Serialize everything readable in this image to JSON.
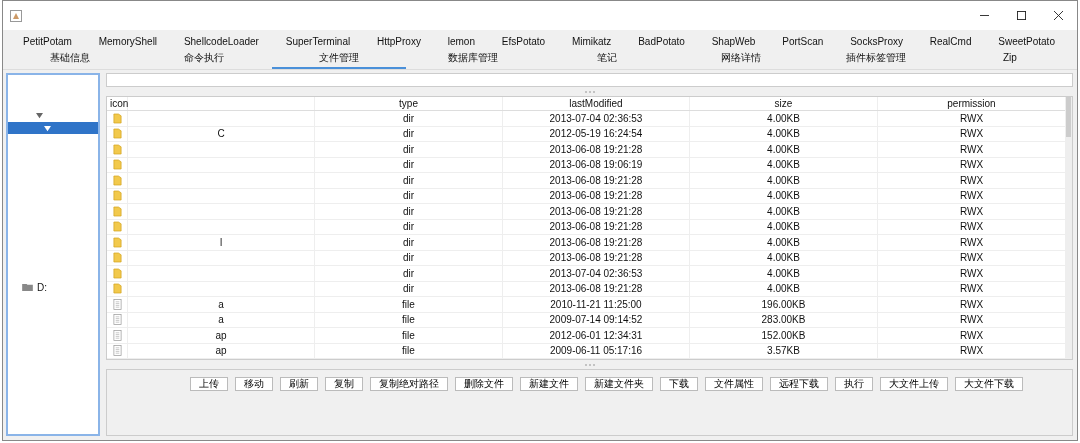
{
  "plugin_tabs": [
    "PetitPotam",
    "MemoryShell",
    "ShellcodeLoader",
    "SuperTerminal",
    "HttpProxy",
    "lemon",
    "EfsPotato",
    "Mimikatz",
    "BadPotato",
    "ShapWeb",
    "PortScan",
    "SocksProxy",
    "RealCmd",
    "SweetPotato"
  ],
  "tabs": [
    {
      "label": "基础信息",
      "selected": false
    },
    {
      "label": "命令执行",
      "selected": false
    },
    {
      "label": "文件管理",
      "selected": true
    },
    {
      "label": "数据库管理",
      "selected": false
    },
    {
      "label": "笔记",
      "selected": false
    },
    {
      "label": "网络详情",
      "selected": false
    },
    {
      "label": "插件标签管理",
      "selected": false
    },
    {
      "label": "Zip",
      "selected": false
    }
  ],
  "tree": [
    {
      "expanded": true,
      "selected": false,
      "children": [
        {
          "expanded": true,
          "selected": true
        }
      ]
    },
    {
      "label": "D:",
      "selected": false
    }
  ],
  "table": {
    "columns": [
      "icon",
      "",
      "type",
      "lastModified",
      "size",
      "permission"
    ],
    "rows": [
      {
        "kind": "dir",
        "name": "",
        "type": "dir",
        "modified": "2013-07-04 02:36:53",
        "size": "4.00KB",
        "permission": "RWX"
      },
      {
        "kind": "dir",
        "name": "C",
        "type": "dir",
        "modified": "2012-05-19 16:24:54",
        "size": "4.00KB",
        "permission": "RWX"
      },
      {
        "kind": "dir",
        "name": "",
        "type": "dir",
        "modified": "2013-06-08 19:21:28",
        "size": "4.00KB",
        "permission": "RWX"
      },
      {
        "kind": "dir",
        "name": "",
        "type": "dir",
        "modified": "2013-06-08 19:06:19",
        "size": "4.00KB",
        "permission": "RWX"
      },
      {
        "kind": "dir",
        "name": "",
        "type": "dir",
        "modified": "2013-06-08 19:21:28",
        "size": "4.00KB",
        "permission": "RWX"
      },
      {
        "kind": "dir",
        "name": "",
        "type": "dir",
        "modified": "2013-06-08 19:21:28",
        "size": "4.00KB",
        "permission": "RWX"
      },
      {
        "kind": "dir",
        "name": "",
        "type": "dir",
        "modified": "2013-06-08 19:21:28",
        "size": "4.00KB",
        "permission": "RWX"
      },
      {
        "kind": "dir",
        "name": "",
        "type": "dir",
        "modified": "2013-06-08 19:21:28",
        "size": "4.00KB",
        "permission": "RWX"
      },
      {
        "kind": "dir",
        "name": "l",
        "type": "dir",
        "modified": "2013-06-08 19:21:28",
        "size": "4.00KB",
        "permission": "RWX"
      },
      {
        "kind": "dir",
        "name": "",
        "type": "dir",
        "modified": "2013-06-08 19:21:28",
        "size": "4.00KB",
        "permission": "RWX"
      },
      {
        "kind": "dir",
        "name": "",
        "type": "dir",
        "modified": "2013-07-04 02:36:53",
        "size": "4.00KB",
        "permission": "RWX"
      },
      {
        "kind": "dir",
        "name": "",
        "type": "dir",
        "modified": "2013-06-08 19:21:28",
        "size": "4.00KB",
        "permission": "RWX"
      },
      {
        "kind": "file",
        "name": "a",
        "type": "file",
        "modified": "2010-11-21 11:25:00",
        "size": "196.00KB",
        "permission": "RWX"
      },
      {
        "kind": "file",
        "name": "a",
        "type": "file",
        "modified": "2009-07-14 09:14:52",
        "size": "283.00KB",
        "permission": "RWX"
      },
      {
        "kind": "file",
        "name": "ap",
        "type": "file",
        "modified": "2012-06-01 12:34:31",
        "size": "152.00KB",
        "permission": "RWX"
      },
      {
        "kind": "file",
        "name": "ap",
        "type": "file",
        "modified": "2009-06-11 05:17:16",
        "size": "3.57KB",
        "permission": "RWX"
      }
    ]
  },
  "buttons": [
    "上传",
    "移动",
    "刷新",
    "复制",
    "复制绝对路径",
    "删除文件",
    "新建文件",
    "新建文件夹",
    "下载",
    "文件属性",
    "远程下载",
    "执行",
    "大文件上传",
    "大文件下载"
  ]
}
